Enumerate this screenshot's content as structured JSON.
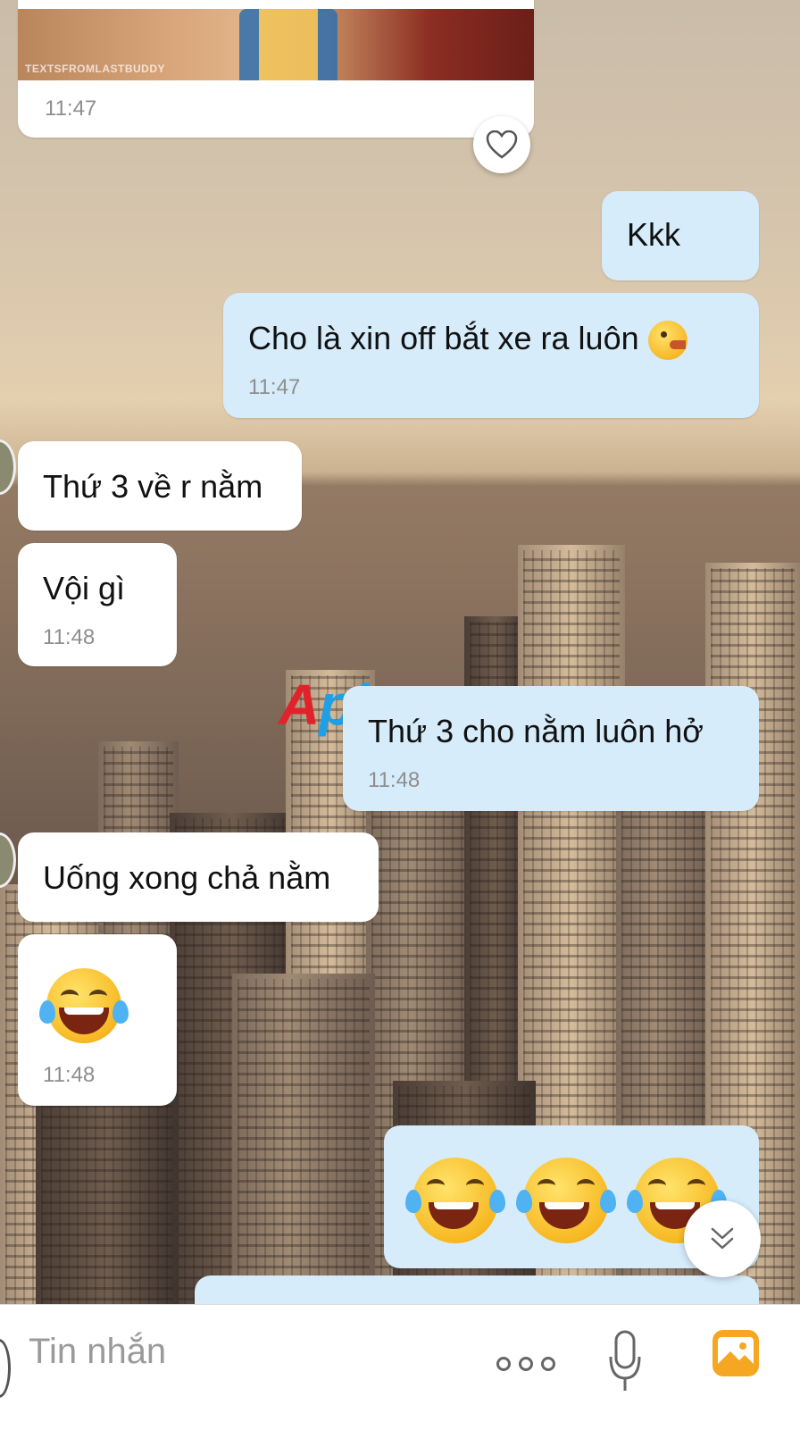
{
  "top_image_message": {
    "watermark": "TEXTSFROMLASTBUDDY",
    "time": "11:47"
  },
  "messages": [
    {
      "id": "m1",
      "dir": "out",
      "text": "Kkk"
    },
    {
      "id": "m2",
      "dir": "out",
      "text": "Cho là xin off bắt xe ra luôn",
      "time": "11:47",
      "emoji": "pacman-face"
    },
    {
      "id": "m3",
      "dir": "in",
      "text": "Thứ 3 về r nằm"
    },
    {
      "id": "m4",
      "dir": "in",
      "text": "Vội gì",
      "time": "11:48"
    },
    {
      "id": "m5",
      "dir": "out",
      "text": "Thứ 3 cho nằm luôn hở",
      "time": "11:48"
    },
    {
      "id": "m6",
      "dir": "in",
      "text": "Uống xong chả nằm"
    },
    {
      "id": "m7",
      "dir": "in",
      "emoji": "tears-of-joy",
      "time": "11:48"
    },
    {
      "id": "m8",
      "dir": "out",
      "emoji": "tears-of-joy x3"
    }
  ],
  "watermark": {
    "part1": "A",
    "part2": "phang"
  },
  "input": {
    "placeholder": "Tin nhắn"
  },
  "icons": [
    "heart-icon",
    "chevron-double-down-icon",
    "more-icon",
    "microphone-icon",
    "photo-icon"
  ],
  "colors": {
    "outgoing_bubble": "#d6ecfb",
    "incoming_bubble": "#ffffff",
    "photo_icon": "#f5a623"
  }
}
